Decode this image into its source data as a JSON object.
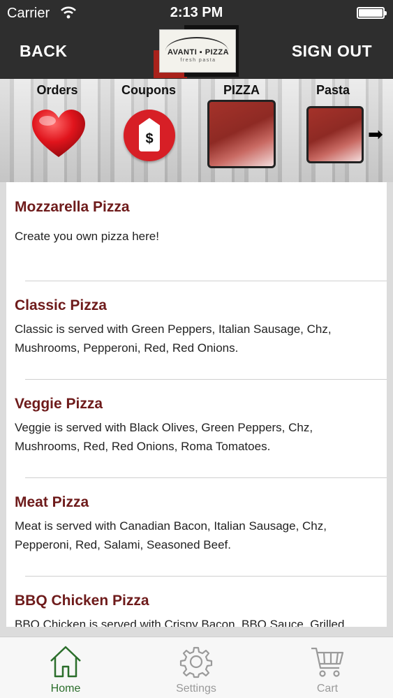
{
  "status_bar": {
    "carrier": "Carrier",
    "time": "2:13 PM"
  },
  "nav": {
    "back_label": "BACK",
    "sign_out_label": "SIGN OUT",
    "logo": {
      "text": "AVANTI ▪ PIZZA",
      "subtext": "fresh pasta"
    }
  },
  "categories": [
    {
      "label": "Orders",
      "icon": "heart-icon"
    },
    {
      "label": "Coupons",
      "icon": "coupon-tag-icon"
    },
    {
      "label": "PIZZA",
      "icon": "pizza-thumbnail"
    },
    {
      "label": "Pasta",
      "icon": "pasta-thumbnail"
    }
  ],
  "menu_items": [
    {
      "name": "Mozzarella Pizza",
      "description": "Create you own pizza here!"
    },
    {
      "name": "Classic Pizza",
      "description": "Classic is served with Green Peppers, Italian Sausage, Chz, Mushrooms, Pepperoni, Red, Red Onions."
    },
    {
      "name": "Veggie Pizza",
      "description": "Veggie is served with Black Olives, Green Peppers, Chz, Mushrooms, Red, Red Onions, Roma Tomatoes."
    },
    {
      "name": "Meat Pizza",
      "description": "Meat is served with Canadian Bacon, Italian Sausage, Chz, Pepperoni, Red, Salami, Seasoned Beef."
    },
    {
      "name": "BBQ Chicken Pizza",
      "description": "BBQ Chicken is served with Crispy Bacon, BBQ Sauce, Grilled"
    }
  ],
  "tabs": [
    {
      "label": "Home",
      "icon": "home-icon",
      "active": true
    },
    {
      "label": "Settings",
      "icon": "gear-icon",
      "active": false
    },
    {
      "label": "Cart",
      "icon": "cart-icon",
      "active": false
    }
  ],
  "colors": {
    "nav_background": "#2e2e2e",
    "item_title": "#6e1b1b",
    "active_tab": "#2b6e2b",
    "inactive_tab": "#9a9a9a",
    "accent_red": "#d71f26"
  }
}
